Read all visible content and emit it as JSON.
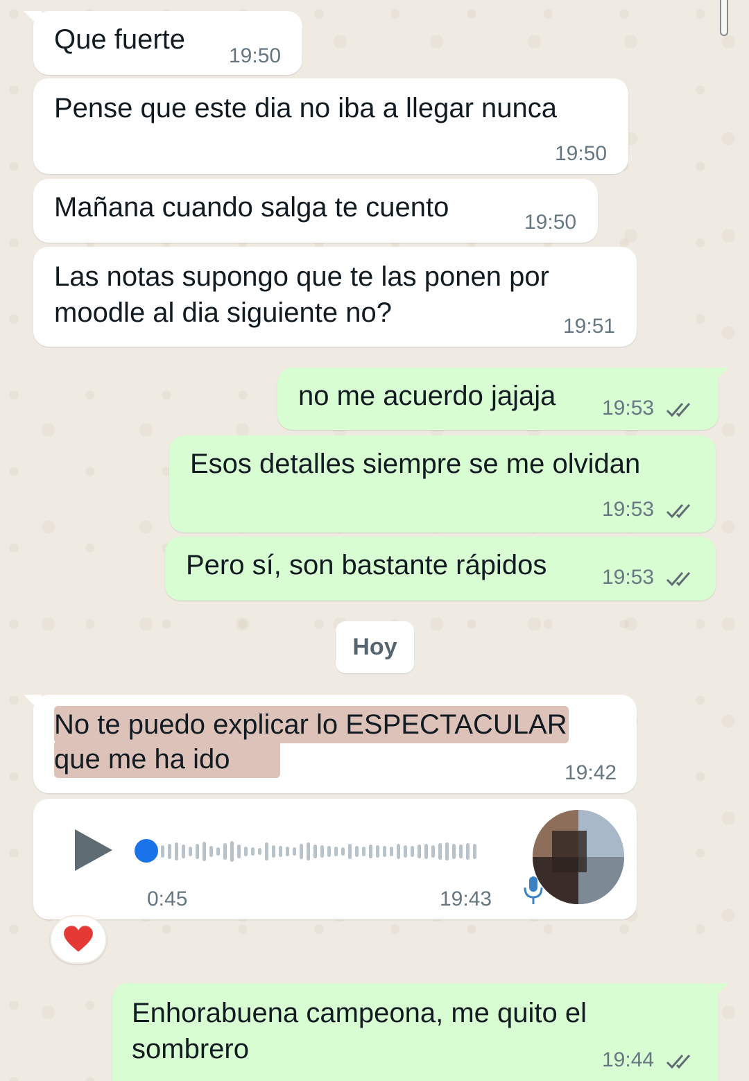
{
  "messages": [
    {
      "id": "m1",
      "direction": "incoming",
      "text": "Que fuerte",
      "time": "19:50"
    },
    {
      "id": "m2",
      "direction": "incoming",
      "text": "Pense que este dia no iba a llegar nunca",
      "time": "19:50"
    },
    {
      "id": "m3",
      "direction": "incoming",
      "text": "Mañana cuando salga te cuento",
      "time": "19:50"
    },
    {
      "id": "m4",
      "direction": "incoming",
      "lines": [
        "Las notas supongo que te las ponen por",
        "moodle al dia siguiente no?"
      ],
      "time": "19:51"
    },
    {
      "id": "m5",
      "direction": "outgoing",
      "text": "no me acuerdo jajaja",
      "time": "19:53",
      "status": "read"
    },
    {
      "id": "m6",
      "direction": "outgoing",
      "text": "Esos detalles siempre se me olvidan",
      "time": "19:53",
      "status": "read"
    },
    {
      "id": "m7",
      "direction": "outgoing",
      "text": "Pero sí, son bastante rápidos",
      "time": "19:53",
      "status": "read"
    },
    {
      "id": "m8",
      "direction": "incoming",
      "lines": [
        "No te puedo explicar lo ESPECTACULAR",
        "que me ha ido"
      ],
      "time": "19:42",
      "highlighted": true
    },
    {
      "id": "m9",
      "direction": "incoming",
      "type": "voice-note",
      "duration": "0:45",
      "time": "19:43",
      "progress": 0.0,
      "reaction": "❤️"
    },
    {
      "id": "m10",
      "direction": "outgoing",
      "lines": [
        "Enhorabuena campeona, me quito el",
        "sombrero"
      ],
      "time": "19:44",
      "status": "read"
    }
  ],
  "date_separator": "Hoy",
  "colors": {
    "wallpaper": "#efeae2",
    "incoming_bubble": "#ffffff",
    "outgoing_bubble": "#d9fdd3",
    "timestamp": "#667781",
    "read_ticks": "#5f6b73",
    "highlight": "#dcc2b9",
    "voice_progress_knob": "#1a73e8",
    "voice_play_icon": "#5f6b73"
  },
  "icons": {
    "read_ticks": "double-check-icon",
    "play": "play-icon",
    "mic": "mic-icon",
    "reaction": "heart-emoji"
  }
}
